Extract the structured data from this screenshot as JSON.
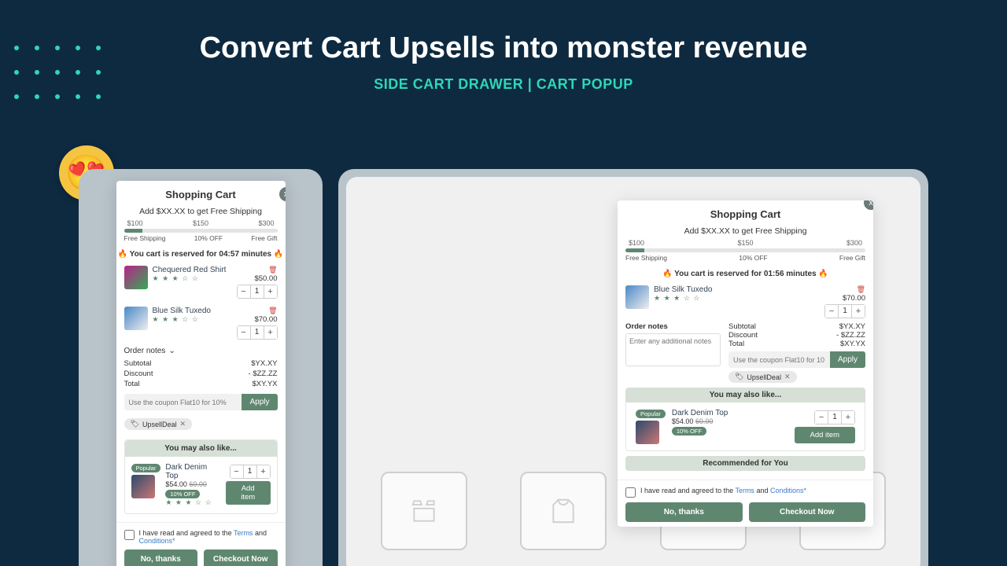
{
  "headline": "Convert Cart Upsells into monster revenue",
  "subhead": "SIDE CART DRAWER | CART POPUP",
  "drawer": {
    "title": "Shopping Cart",
    "ship_msg": "Add $XX.XX to get Free Shipping",
    "tiers": {
      "a": "$100",
      "b": "$150",
      "c": "$300"
    },
    "tier_labels": {
      "a": "Free Shipping",
      "b": "10% OFF",
      "c": "Free Gift"
    },
    "reserve": "🔥 You cart is reserved for 04:57 minutes 🔥",
    "items": [
      {
        "name": "Chequered Red Shirt",
        "price": "$50.00",
        "qty": "1"
      },
      {
        "name": "Blue Silk Tuxedo",
        "price": "$70.00",
        "qty": "1"
      }
    ],
    "notes_label": "Order notes",
    "summary": {
      "subtotal_l": "Subtotal",
      "subtotal_v": "$YX.XY",
      "discount_l": "Discount",
      "discount_v": "- $ZZ.ZZ",
      "total_l": "Total",
      "total_v": "$XY.YX"
    },
    "coupon_ph": "Use the coupon Flat10 for 10%",
    "apply": "Apply",
    "tag": "UpsellDeal",
    "upsell": {
      "head": "You may also like...",
      "badge": "Popular",
      "name": "Dark Denim Top",
      "price": "$54.00",
      "old": "60.00",
      "off": "10% OFF",
      "add": "Add item",
      "qty": "1"
    },
    "agree_pre": "I have read and agreed to the ",
    "terms": "Terms",
    "and": " and ",
    "cond": "Conditions*",
    "no": "No, thanks",
    "checkout": "Checkout Now"
  },
  "popup": {
    "title": "Shopping Cart",
    "ship_msg": "Add $XX.XX to get Free Shipping",
    "tiers": {
      "a": "$100",
      "b": "$150",
      "c": "$300"
    },
    "tier_labels": {
      "a": "Free Shipping",
      "b": "10% OFF",
      "c": "Free Gift"
    },
    "reserve": "🔥 You cart is reserved for 01:56 minutes 🔥",
    "item": {
      "name": "Blue Silk Tuxedo",
      "price": "$70.00",
      "qty": "1"
    },
    "notes_label": "Order notes",
    "notes_ph": "Enter any additional notes",
    "summary": {
      "subtotal_l": "Subtotal",
      "subtotal_v": "$YX.XY",
      "discount_l": "Discount",
      "discount_v": "- $ZZ.ZZ",
      "total_l": "Total",
      "total_v": "$XY.YX"
    },
    "coupon_ph": "Use the coupon Flat10 for 10",
    "apply": "Apply",
    "tag": "UpsellDeal",
    "upsell": {
      "head": "You may also like...",
      "badge": "Popular",
      "name": "Dark Denim Top",
      "price": "$54.00",
      "old": "60.00",
      "off": "10% OFF",
      "add": "Add item",
      "qty": "1"
    },
    "rec_head": "Recommended for You",
    "agree_pre": "I have read and agreed to the ",
    "terms": "Terms",
    "and": " and ",
    "cond": "Conditions*",
    "no": "No, thanks",
    "checkout": "Checkout Now"
  }
}
